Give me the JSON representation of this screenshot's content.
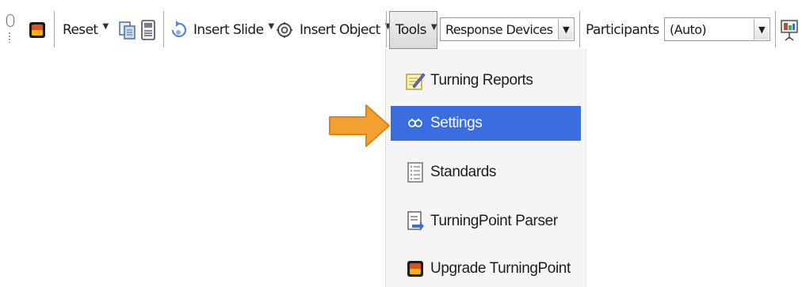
{
  "toolbar": {
    "reset_label": "Reset",
    "insert_slide_label": "Insert Slide",
    "insert_object_label": "Insert Object",
    "tools_label": "Tools",
    "response_devices_value": "Response Devices",
    "participants_label": "Participants",
    "participants_value": "(Auto)"
  },
  "tools_menu": {
    "items": [
      {
        "label": "Turning Reports",
        "icon": "notepad-pencil-icon"
      },
      {
        "label": "Settings",
        "icon": "settings-icon",
        "highlighted": true
      },
      {
        "label": "Standards",
        "icon": "list-document-icon"
      },
      {
        "label": "TurningPoint Parser",
        "icon": "parser-document-icon"
      },
      {
        "label": "Upgrade TurningPoint",
        "icon": "turningpoint-logo-icon"
      }
    ]
  },
  "colors": {
    "menu_highlight": "#3a6ee0",
    "pointer_arrow": "#f2a030",
    "menu_background": "#f5f5f5"
  }
}
